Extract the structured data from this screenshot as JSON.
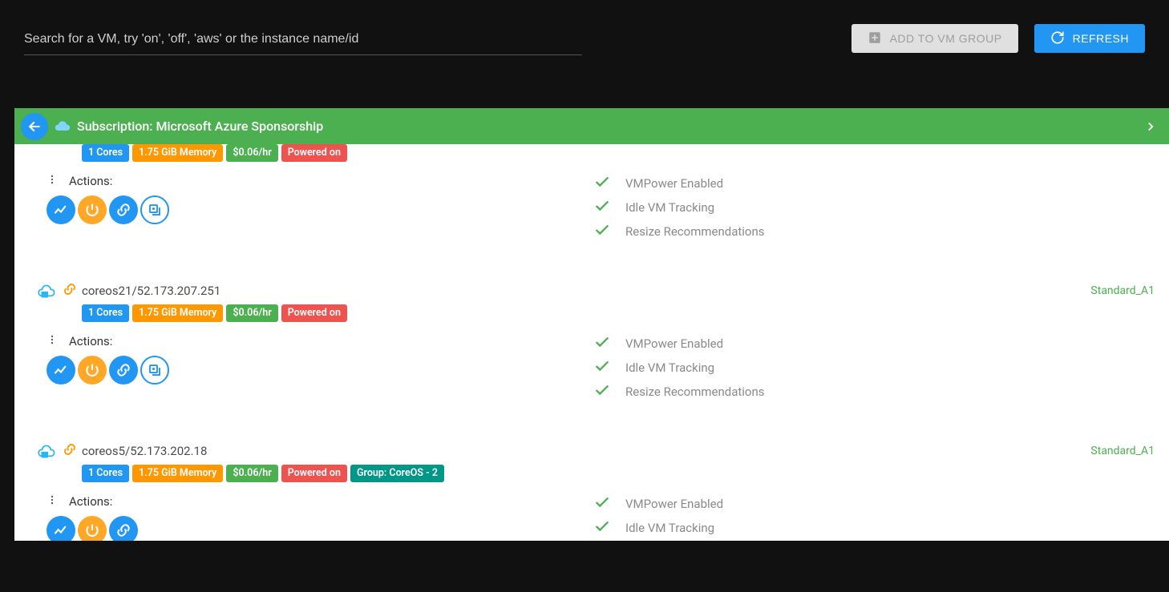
{
  "search": {
    "placeholder": "Search for a VM, try 'on', 'off', 'aws' or the instance name/id"
  },
  "buttons": {
    "add_to_vm_group": "ADD TO VM GROUP",
    "refresh": "REFRESH"
  },
  "panel": {
    "title": "Subscription: Microsoft Azure Sponsorship"
  },
  "common": {
    "actions_label": "Actions:",
    "checks": {
      "vmpower": "VMPower Enabled",
      "idle": "Idle VM Tracking",
      "resize": "Resize Recommendations"
    }
  },
  "vms": [
    {
      "name": "",
      "size": "",
      "badges": {
        "cores": "1 Cores",
        "memory": "1.75 GiB Memory",
        "price": "$0.06/hr",
        "power": "Powered on",
        "group": ""
      },
      "show_add_fab": true
    },
    {
      "name": "coreos21/52.173.207.251",
      "size": "Standard_A1",
      "badges": {
        "cores": "1 Cores",
        "memory": "1.75 GiB Memory",
        "price": "$0.06/hr",
        "power": "Powered on",
        "group": ""
      },
      "show_add_fab": true
    },
    {
      "name": "coreos5/52.173.202.18",
      "size": "Standard_A1",
      "badges": {
        "cores": "1 Cores",
        "memory": "1.75 GiB Memory",
        "price": "$0.06/hr",
        "power": "Powered on",
        "group": "Group: CoreOS - 2"
      },
      "show_add_fab": false
    }
  ]
}
